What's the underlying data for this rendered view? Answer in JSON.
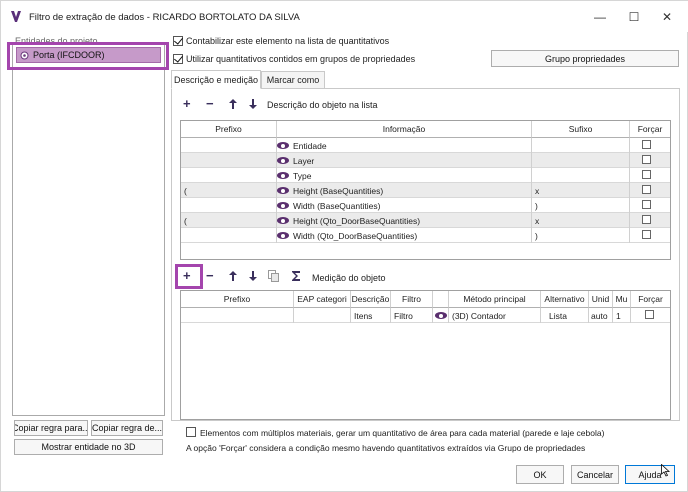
{
  "window": {
    "title": "Filtro de extração de dados - RICARDO BORTOLATO DA SILVA",
    "minimize": "—",
    "maximize": "☐",
    "close": "✕"
  },
  "left": {
    "heading": "Entidades do projeto",
    "entity": "Porta (IFCDOOR)",
    "copy_rule_1": "Copiar regra para...",
    "copy_rule_2": "Copiar regra de...",
    "show_entity": "Mostrar entidade no 3D"
  },
  "options": {
    "count_element": "Contabilizar este elemento na lista de quantitativos",
    "use_groups": "Utilizar quantitativos contidos em grupos de propriedades",
    "group_button": "Grupo propriedades"
  },
  "tabs": [
    {
      "label": "Descrição e medição"
    },
    {
      "label": "Marcar como"
    }
  ],
  "description": {
    "toolbar_label": "Descrição do objeto na lista",
    "columns": [
      "Prefixo",
      "Informação",
      "Sufixo",
      "Forçar"
    ],
    "rows": [
      {
        "prefix": "",
        "info": "Entidade",
        "suffix": ""
      },
      {
        "prefix": "",
        "info": "Layer",
        "suffix": ""
      },
      {
        "prefix": "",
        "info": "Type",
        "suffix": ""
      },
      {
        "prefix": "(",
        "info": "Height (BaseQuantities)",
        "suffix": "x"
      },
      {
        "prefix": "",
        "info": "Width (BaseQuantities)",
        "suffix": ")"
      },
      {
        "prefix": "(",
        "info": "Height (Qto_DoorBaseQuantities)",
        "suffix": "x"
      },
      {
        "prefix": "",
        "info": "Width (Qto_DoorBaseQuantities)",
        "suffix": ")"
      }
    ]
  },
  "measurement": {
    "toolbar_label": "Medição do objeto",
    "columns": [
      "Prefixo",
      "EAP categori",
      "Descrição",
      "Filtro",
      "",
      "Método principal",
      "Alternativo",
      "Unid",
      "Mu",
      "Forçar"
    ],
    "rows": [
      {
        "prefix": "",
        "eap": "",
        "desc": "Itens",
        "filter": "Filtro",
        "method": "(3D) Contador",
        "alt": "Lista",
        "unit": "auto",
        "mult": "1"
      }
    ]
  },
  "footer": {
    "multi_material": "Elementos com múltiplos materiais, gerar um quantitativo de área para cada material (parede e laje cebola)",
    "note": "A opção 'Forçar' considera a condição mesmo havendo quantitativos extraídos via Grupo de propriedades",
    "ok": "OK",
    "cancel": "Cancelar",
    "help": "Ajuda"
  },
  "colors": {
    "highlight": "#a445ad",
    "selected_entity": "#c69ac9",
    "icon": "#3a2f5c"
  }
}
